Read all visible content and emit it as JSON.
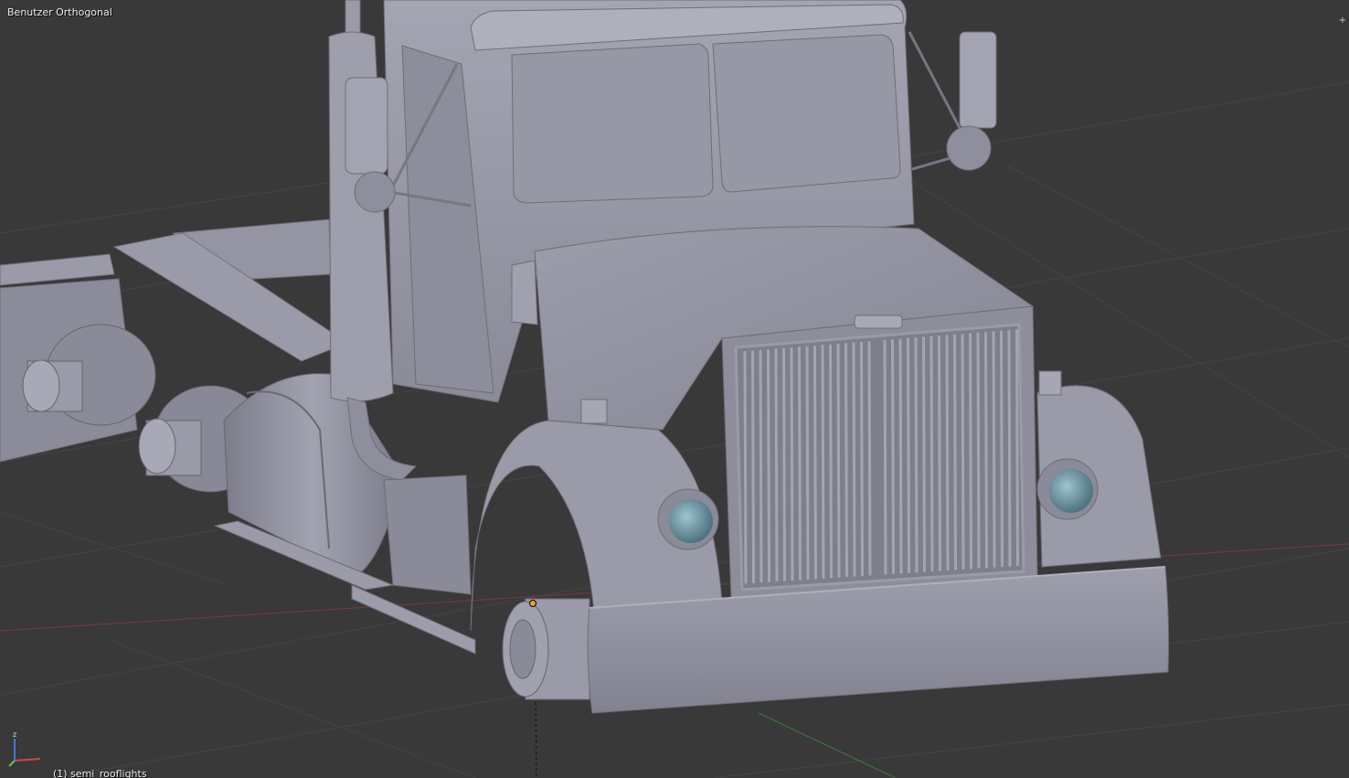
{
  "viewport": {
    "view_title": "Benutzer Orthogonal",
    "object_label": "(1) semi_rooflights",
    "corner_widget_icon": "plus-icon"
  },
  "axis_gizmo": {
    "x_label": "",
    "z_label": "z",
    "x_color": "#d0474a",
    "y_color": "#63c94a",
    "z_color": "#4a76d0"
  },
  "colors": {
    "background": "#393939",
    "grid": "#434343",
    "model": "#8e8e9c",
    "lens": "#5f8592",
    "origin": "#f0a030"
  }
}
